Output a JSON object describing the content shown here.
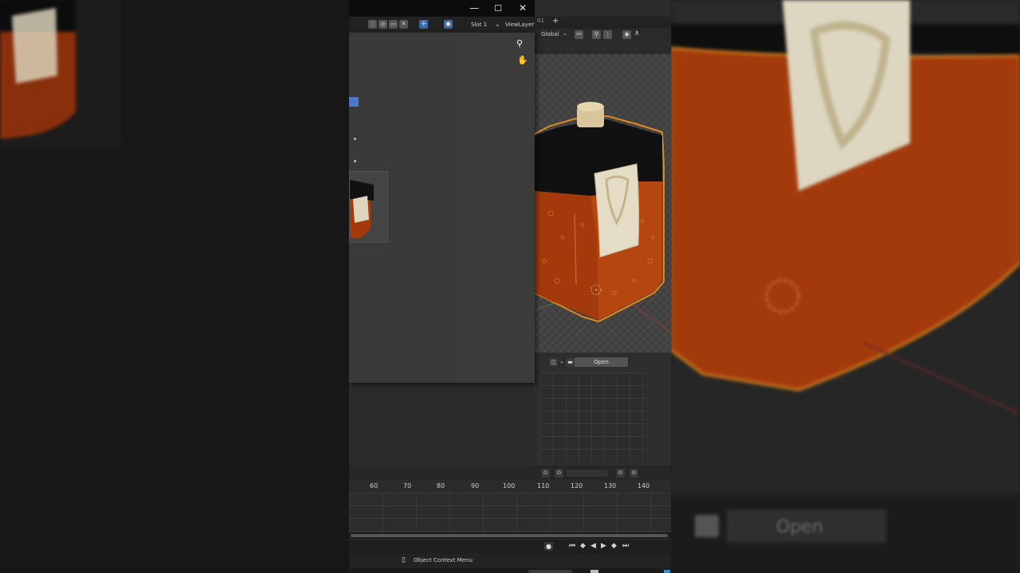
{
  "window": {
    "minimize_glyph": "—",
    "maximize_glyph": "☐",
    "close_glyph": "✕"
  },
  "header": {
    "slot_label": "Slot 1",
    "view_layer_label": "ViewLayer",
    "tab_suffix": "01",
    "add_tab_glyph": "+",
    "transform_orientation": "Global"
  },
  "image_editor": {
    "open_label": "Open"
  },
  "timeline": {
    "frame_ticks": [
      "60",
      "70",
      "80",
      "90",
      "100",
      "110",
      "120",
      "130",
      "140"
    ],
    "status_hint": "Object Context Menu"
  },
  "blurred_right": {
    "open_label": "Open"
  },
  "colors": {
    "selection_outline": "#e08a1e",
    "bottle_liquid": "#b0400e",
    "bottle_cap": "#141414",
    "cork": "#d7c39a",
    "label": "#e8e0c8",
    "accent_blue": "#4a78c8"
  },
  "icons": [
    "zoom-icon",
    "hand-icon",
    "camera-icon",
    "folder-icon",
    "cursor-3d-icon",
    "jump-start-icon",
    "prev-key-icon",
    "play-reverse-icon",
    "play-icon",
    "next-key-icon",
    "jump-end-icon",
    "record-icon",
    "mouse-icon"
  ]
}
